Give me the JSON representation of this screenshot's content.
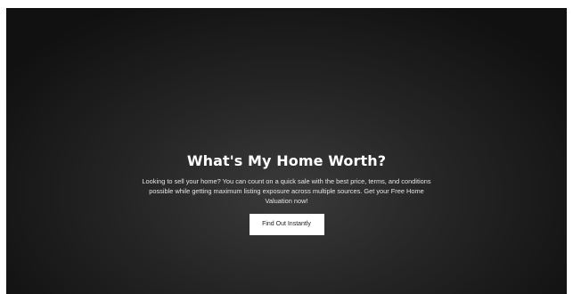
{
  "hero": {
    "title": "What's My Home Worth?",
    "description": "Looking to sell your home? You can count on a quick sale with the best price, terms, and conditions possible while getting maximum listing exposure across multiple sources. Get your Free Home Valuation now!",
    "button_label": "Find Out Instantly"
  },
  "colors": {
    "background": "#1c1c1c",
    "text": "#ffffff",
    "button_background": "#ffffff",
    "button_text": "#222222"
  }
}
